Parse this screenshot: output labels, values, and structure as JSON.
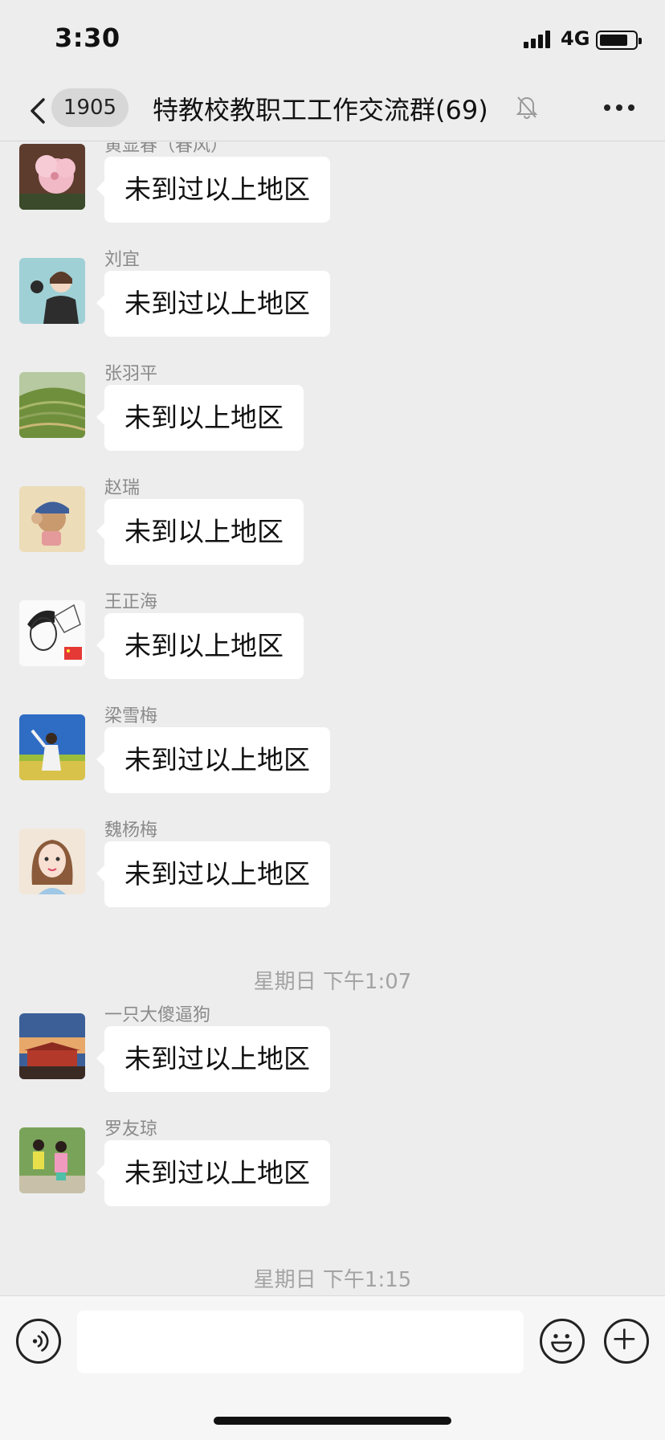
{
  "status_bar": {
    "time": "3:30",
    "network": "4G"
  },
  "nav": {
    "unread_count": "1905",
    "title": "特教校教职工工作交流群(69)",
    "icons": [
      "back-icon",
      "mute-bell-icon",
      "more-icon"
    ]
  },
  "messages": [
    {
      "sender": "黄显春（春风）",
      "text": "未到过以上地区"
    },
    {
      "sender": "刘宜",
      "text": "未到过以上地区"
    },
    {
      "sender": "张羽平",
      "text": "未到以上地区"
    },
    {
      "sender": "赵瑞",
      "text": "未到以上地区"
    },
    {
      "sender": "王正海",
      "text": "未到以上地区"
    },
    {
      "sender": "梁雪梅",
      "text": "未到过以上地区"
    },
    {
      "sender": "魏杨梅",
      "text": "未到过以上地区"
    },
    {
      "sender": "一只大傻逼狗",
      "text": "未到过以上地区"
    },
    {
      "sender": "罗友琼",
      "text": "未到过以上地区"
    }
  ],
  "time_dividers": [
    "星期日 下午1:07",
    "星期日 下午1:15"
  ],
  "input_bar": {
    "placeholder": "",
    "icons": [
      "voice-icon",
      "emoji-icon",
      "plus-icon"
    ]
  }
}
